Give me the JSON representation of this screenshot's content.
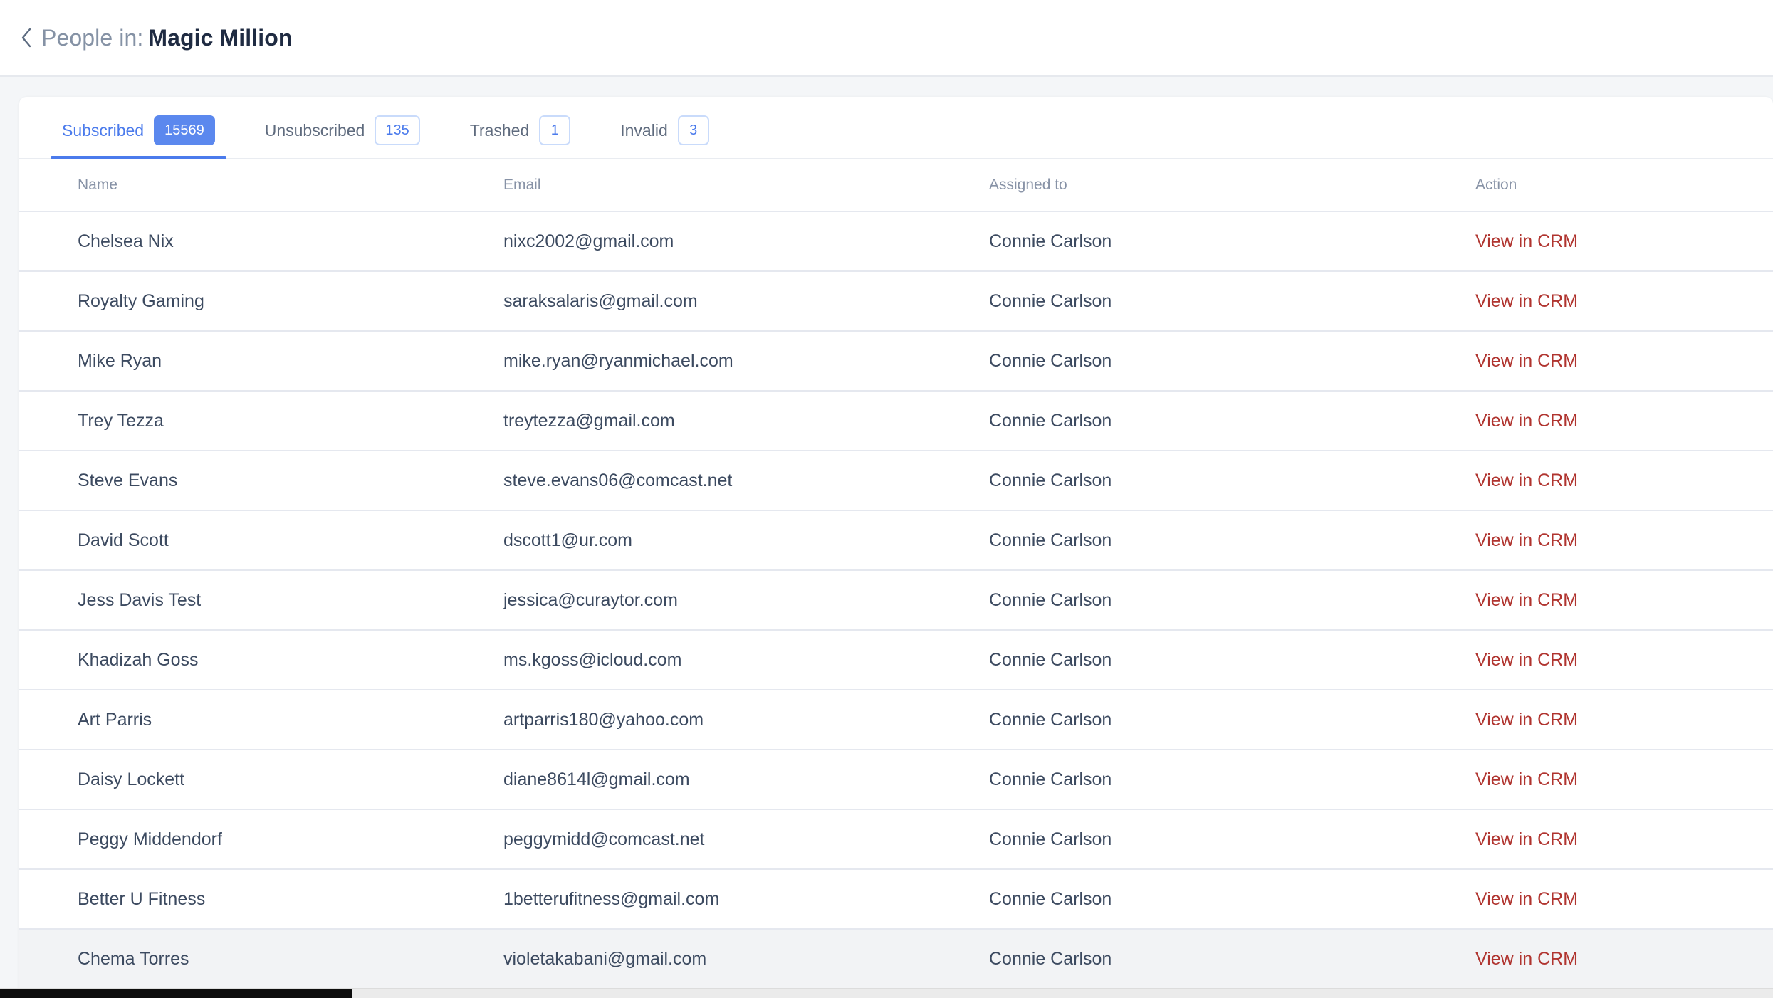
{
  "header": {
    "back_icon": "chevron-left-icon",
    "title_prefix": "People in:",
    "title_entity": "Magic Million"
  },
  "tabs": [
    {
      "label": "Subscribed",
      "count": "15569",
      "active": true
    },
    {
      "label": "Unsubscribed",
      "count": "135",
      "active": false
    },
    {
      "label": "Trashed",
      "count": "1",
      "active": false
    },
    {
      "label": "Invalid",
      "count": "3",
      "active": false
    }
  ],
  "table": {
    "columns": [
      "Name",
      "Email",
      "Assigned to",
      "Action"
    ],
    "action_label": "View in CRM",
    "rows": [
      {
        "name": "Chelsea Nix",
        "email": "nixc2002@gmail.com",
        "assigned": "Connie Carlson",
        "action": "View in CRM"
      },
      {
        "name": "Royalty Gaming",
        "email": "saraksalaris@gmail.com",
        "assigned": "Connie Carlson",
        "action": "View in CRM"
      },
      {
        "name": "Mike Ryan",
        "email": "mike.ryan@ryanmichael.com",
        "assigned": "Connie Carlson",
        "action": "View in CRM"
      },
      {
        "name": "Trey Tezza",
        "email": "treytezza@gmail.com",
        "assigned": "Connie Carlson",
        "action": "View in CRM"
      },
      {
        "name": "Steve Evans",
        "email": "steve.evans06@comcast.net",
        "assigned": "Connie Carlson",
        "action": "View in CRM"
      },
      {
        "name": "David Scott",
        "email": "dscott1@ur.com",
        "assigned": "Connie Carlson",
        "action": "View in CRM"
      },
      {
        "name": "Jess Davis Test",
        "email": "jessica@curaytor.com",
        "assigned": "Connie Carlson",
        "action": "View in CRM"
      },
      {
        "name": "Khadizah Goss",
        "email": "ms.kgoss@icloud.com",
        "assigned": "Connie Carlson",
        "action": "View in CRM"
      },
      {
        "name": "Art Parris",
        "email": "artparris180@yahoo.com",
        "assigned": "Connie Carlson",
        "action": "View in CRM"
      },
      {
        "name": "Daisy Lockett",
        "email": "diane8614l@gmail.com",
        "assigned": "Connie Carlson",
        "action": "View in CRM"
      },
      {
        "name": "Peggy Middendorf",
        "email": "peggymidd@comcast.net",
        "assigned": "Connie Carlson",
        "action": "View in CRM"
      },
      {
        "name": "Better U Fitness",
        "email": "1betterufitness@gmail.com",
        "assigned": "Connie Carlson",
        "action": "View in CRM"
      },
      {
        "name": "Chema Torres",
        "email": "violetakabani@gmail.com",
        "assigned": "Connie Carlson",
        "action": "View in CRM",
        "hovered": true
      }
    ]
  },
  "colors": {
    "accent_blue": "#4b7bec",
    "badge_blue": "#5b88ee",
    "crm_red": "#b0342f",
    "title_dark": "#1f2b42",
    "muted_gray": "#8592a5",
    "page_bg": "#f4f6f8"
  }
}
